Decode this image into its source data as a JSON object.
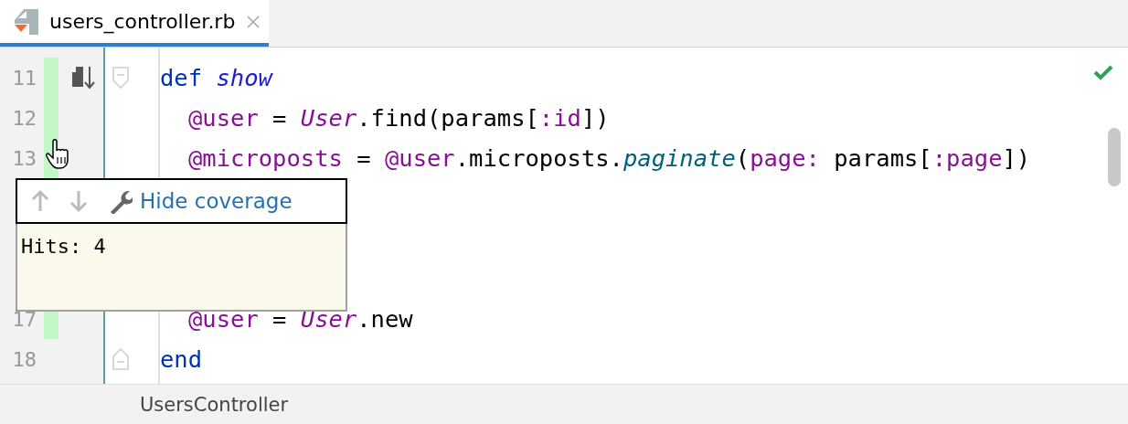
{
  "tab": {
    "label": "users_controller.rb",
    "selected": true
  },
  "lines": [
    {
      "kind": "code",
      "number": "11",
      "covered": true,
      "indented": false,
      "fold": {
        "kind": "start"
      },
      "tokens": [
        {
          "kind": "keyword",
          "text": "def "
        },
        {
          "kind": "method-def",
          "text": "show"
        }
      ]
    },
    {
      "kind": "code",
      "number": "12",
      "covered": true,
      "indented": true,
      "tokens": [
        {
          "kind": "ivar",
          "text": "@user"
        },
        {
          "kind": "plain",
          "text": " = "
        },
        {
          "kind": "constant",
          "text": "User"
        },
        {
          "kind": "plain",
          "text": ".find(params["
        },
        {
          "kind": "symbol",
          "text": ":id"
        },
        {
          "kind": "plain",
          "text": "])"
        }
      ]
    },
    {
      "kind": "code",
      "number": "13",
      "covered": true,
      "indented": true,
      "tokens": [
        {
          "kind": "ivar",
          "text": "@microposts"
        },
        {
          "kind": "plain",
          "text": " = "
        },
        {
          "kind": "ivar",
          "text": "@user"
        },
        {
          "kind": "plain",
          "text": ".microposts."
        },
        {
          "kind": "call",
          "text": "paginate"
        },
        {
          "kind": "plain",
          "text": "("
        },
        {
          "kind": "symbol",
          "text": "page:"
        },
        {
          "kind": "plain",
          "text": " params["
        },
        {
          "kind": "symbol",
          "text": ":page"
        },
        {
          "kind": "plain",
          "text": "])"
        }
      ]
    },
    {
      "kind": "covered-by-popup"
    },
    {
      "kind": "covered-by-popup"
    },
    {
      "kind": "covered-by-popup"
    },
    {
      "kind": "code",
      "number": "17",
      "covered": true,
      "indented": true,
      "tokens": [
        {
          "kind": "ivar",
          "text": "@user"
        },
        {
          "kind": "plain",
          "text": " = "
        },
        {
          "kind": "constant",
          "text": "User"
        },
        {
          "kind": "plain",
          "text": ".new"
        }
      ]
    },
    {
      "kind": "code",
      "number": "18",
      "covered": false,
      "indented": false,
      "fold": {
        "kind": "end"
      },
      "tokens": [
        {
          "kind": "keyword",
          "text": "end"
        }
      ]
    }
  ],
  "popup": {
    "actions": [
      {
        "kind": "up",
        "disabled": true
      },
      {
        "kind": "down",
        "disabled": true
      }
    ],
    "link": "Hide coverage",
    "text": "Hits: 4"
  },
  "status_bar": {
    "breadcrumb": "UsersController"
  }
}
